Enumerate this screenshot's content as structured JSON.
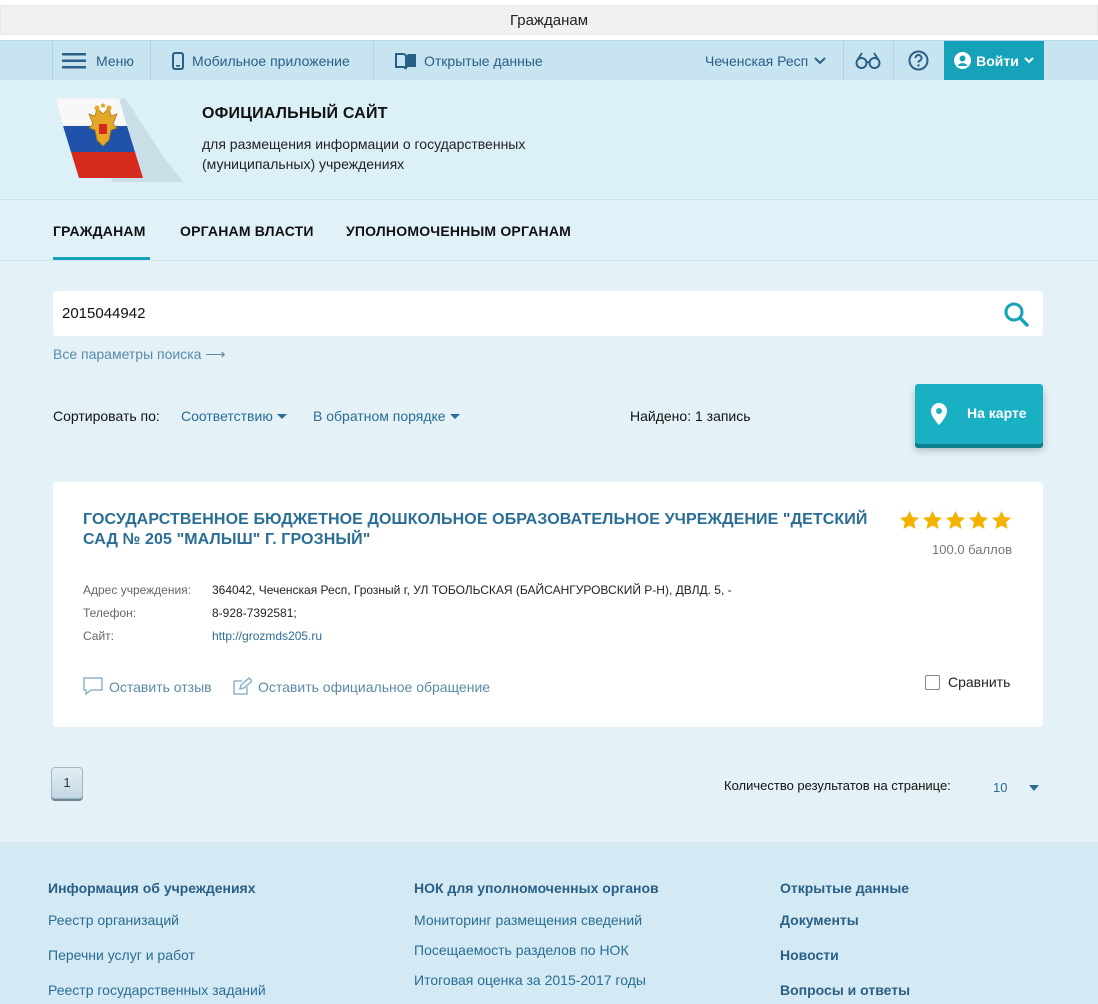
{
  "window": {
    "title": "Гражданам"
  },
  "topbar": {
    "menu": "Меню",
    "mobile_app": "Мобильное приложение",
    "open_data": "Открытые данные",
    "region": "Чеченская Респ",
    "login": "Войти"
  },
  "header": {
    "title": "ОФИЦИАЛЬНЫЙ САЙТ",
    "subtitle": "для размещения информации о государственных (муниципальных) учреждениях"
  },
  "nav": {
    "citizens": "ГРАЖДАНАМ",
    "authorities": "ОРГАНАМ ВЛАСТИ",
    "authorized": "УПОЛНОМОЧЕННЫМ ОРГАНАМ"
  },
  "search": {
    "value": "2015044942",
    "all_params": "Все параметры поиска ⟶"
  },
  "sort": {
    "label": "Сортировать по:",
    "relevance": "Соответствию",
    "order": "В обратном порядке",
    "found": "Найдено: 1 запись",
    "map_button": "На карте"
  },
  "result": {
    "title": "ГОСУДАРСТВЕННОЕ БЮДЖЕТНОЕ ДОШКОЛЬНОЕ ОБРАЗОВАТЕЛЬНОЕ УЧРЕЖДЕНИЕ \"ДЕТСКИЙ САД № 205 \"МАЛЫШ\" Г. ГРОЗНЫЙ\"",
    "rating_stars": 5,
    "score": "100.0 баллов",
    "address_label": "Адрес учреждения:",
    "address": "364042, Чеченская Респ, Грозный г, УЛ ТОБОЛЬСКАЯ (БАЙСАНГУРОВСКИЙ Р-Н), ДВЛД. 5, -",
    "phone_label": "Телефон:",
    "phone": "8-928-7392581;",
    "site_label": "Сайт:",
    "site": "http://grozmds205.ru",
    "review": "Оставить отзыв",
    "appeal": "Оставить официальное обращение",
    "compare": "Сравнить"
  },
  "pagination": {
    "current": "1",
    "per_page_label": "Количество результатов на странице:",
    "per_page_value": "10"
  },
  "footer": {
    "col1": {
      "heading": "Информация об учреждениях",
      "links": [
        "Реестр организаций",
        "Перечни услуг и работ",
        "Реестр государственных заданий"
      ]
    },
    "col2": {
      "heading": "НОК для уполномоченных органов",
      "links": [
        "Мониторинг размещения сведений",
        "Посещаемость разделов по НОК",
        "Итоговая оценка за 2015-2017 годы"
      ]
    },
    "col3": {
      "heading": "Открытые данные",
      "links": [
        "Документы",
        "Новости",
        "Вопросы и ответы"
      ]
    }
  },
  "colors": {
    "accent": "#16a3b9",
    "link": "#2a6d95",
    "star": "#f5b200"
  }
}
